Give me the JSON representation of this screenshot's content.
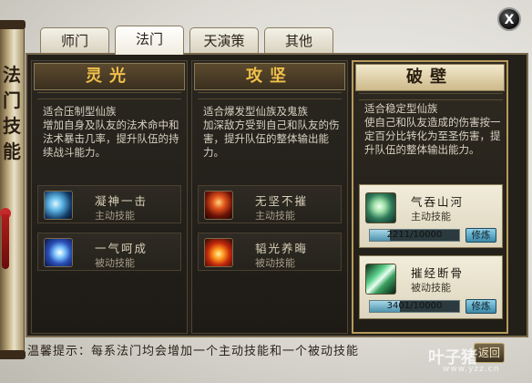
{
  "sidebar": {
    "title": "法门技能"
  },
  "window": {
    "close_label": "X"
  },
  "tabs": [
    {
      "label": "师门"
    },
    {
      "label": "法门"
    },
    {
      "label": "天演策"
    },
    {
      "label": "其他"
    }
  ],
  "columns": [
    {
      "title": "灵光",
      "description": "适合压制型仙族\n增加自身及队友的法术命中和法术暴击几率，提升队伍的持续战斗能力。",
      "skills": [
        {
          "name": "凝神一击",
          "type": "主动技能",
          "icon": "spirit-beast-icon"
        },
        {
          "name": "一气呵成",
          "type": "被动技能",
          "icon": "blue-swirl-icon"
        }
      ]
    },
    {
      "title": "攻坚",
      "description": "适合爆发型仙族及鬼族\n加深敌方受到自己和队友的伤害，提升队伍的整体输出能力。",
      "skills": [
        {
          "name": "无坚不摧",
          "type": "主动技能",
          "icon": "fire-warrior-icon"
        },
        {
          "name": "韬光养晦",
          "type": "被动技能",
          "icon": "fire-burst-icon"
        }
      ]
    },
    {
      "title": "破壁",
      "description": "适合稳定型仙族\n使自己和队友造成的伤害按一定百分比转化为至圣伤害，提升队伍的整体输出能力。",
      "skills": [
        {
          "name": "气吞山河",
          "type": "主动技能",
          "icon": "dragon-head-icon",
          "progress_text": "2211/10000",
          "progress": 0.2211,
          "button": "修炼"
        },
        {
          "name": "摧经断骨",
          "type": "被动技能",
          "icon": "green-blades-icon",
          "progress_text": "3401/10000",
          "progress": 0.3401,
          "button": "修炼"
        }
      ]
    }
  ],
  "footer": {
    "tip": "温馨提示：每系法门均会增加一个主动技能和一个被动技能",
    "corner_button": "返回"
  },
  "watermark": {
    "brand": "叶子猪",
    "url": "www.yzz.cn"
  }
}
